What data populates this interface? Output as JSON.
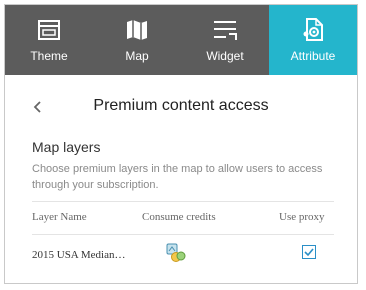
{
  "tabs": [
    {
      "label": "Theme",
      "icon": "theme-icon"
    },
    {
      "label": "Map",
      "icon": "map-icon"
    },
    {
      "label": "Widget",
      "icon": "widget-icon"
    },
    {
      "label": "Attribute",
      "icon": "attribute-icon",
      "active": true
    }
  ],
  "panel": {
    "title": "Premium content access",
    "section_title": "Map layers",
    "description": "Choose premium layers in the map to allow users to access through your subscription."
  },
  "table": {
    "columns": [
      "Layer Name",
      "Consume credits",
      "Use proxy"
    ],
    "rows": [
      {
        "layer_name": "2015 USA Median…",
        "credits_icon": "credits-icon",
        "use_proxy": true
      }
    ]
  },
  "colors": {
    "tab_bar": "#5c5c5c",
    "active_tab": "#24b5cc",
    "checkbox": "#2a8fc7"
  }
}
